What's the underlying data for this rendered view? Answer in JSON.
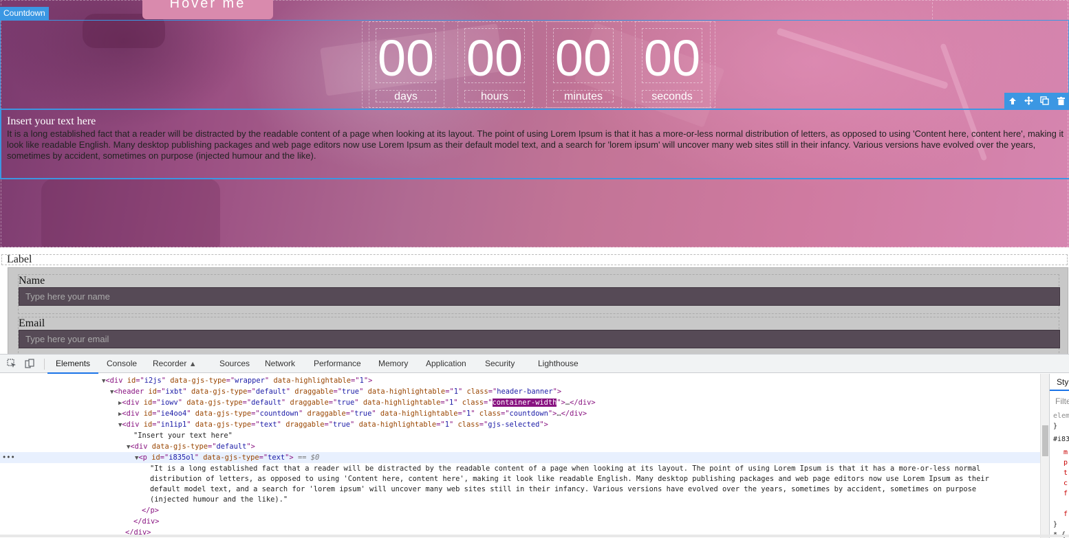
{
  "canvas": {
    "component_badge": "Countdown",
    "hover_button": "Hover me",
    "countdown": [
      {
        "value": "00",
        "label": "days"
      },
      {
        "value": "00",
        "label": "hours"
      },
      {
        "value": "00",
        "label": "minutes"
      },
      {
        "value": "00",
        "label": "seconds"
      }
    ],
    "toolbar_icons": [
      "arrow-up-icon",
      "move-icon",
      "copy-icon",
      "delete-icon"
    ],
    "text_block": {
      "title": "Insert your text here",
      "paragraph": "It is a long established fact that a reader will be distracted by the readable content of a page when looking at its layout. The point of using Lorem Ipsum is that it has a more-or-less normal distribution of letters, as opposed to using 'Content here, content here', making it look like readable English. Many desktop publishing packages and web page editors now use Lorem Ipsum as their default model text, and a search for 'lorem ipsum' will uncover many web sites still in their infancy. Various versions have evolved over the years, sometimes by accident, sometimes on purpose (injected humour and the like)."
    },
    "form": {
      "label": "Label",
      "name_label": "Name",
      "name_placeholder": "Type here your name",
      "email_label": "Email",
      "email_placeholder": "Type here your email"
    }
  },
  "devtools": {
    "tabs": [
      "Elements",
      "Console",
      "Recorder",
      "Sources",
      "Network",
      "Performance",
      "Memory",
      "Application",
      "Security",
      "Lighthouse"
    ],
    "active_tab": "Elements",
    "recorder_icon": "flask-icon",
    "styles_tab": "Styl",
    "styles_filter": "Filte",
    "styles_lines": [
      "elem",
      "}",
      "#i83",
      "m",
      "p",
      "t",
      "c",
      "f",
      "",
      "f",
      "}",
      "* {"
    ],
    "dom": {
      "line_wrapper": {
        "id": "i2js",
        "type": "wrapper",
        "highlightable": "1"
      },
      "line_header": {
        "id": "ixbt",
        "type": "default",
        "draggable": "true",
        "highlightable": "1",
        "class": "header-banner"
      },
      "line_iowv": {
        "id": "iowv",
        "type": "default",
        "draggable": "true",
        "highlightable": "1",
        "class": "container-width"
      },
      "line_ie4oo4": {
        "id": "ie4oo4",
        "type": "countdown",
        "draggable": "true",
        "highlightable": "1",
        "class": "countdown"
      },
      "line_in1ip1": {
        "id": "in1ip1",
        "type": "text",
        "draggable": "true",
        "highlightable": "1",
        "class": "gjs-selected"
      },
      "text_node": "\"Insert your text here\"",
      "line_default_div": {
        "type": "default"
      },
      "line_p": {
        "id": "i835ol",
        "type": "text",
        "console_ref": "== $0"
      },
      "p_text": [
        "\"It is a long established fact that a reader will be distracted by the readable content of a page when looking at its layout. The point of using Lorem Ipsum is that it has a more-or-less normal",
        "distribution of letters, as opposed to using 'Content here, content here', making it look like readable English. Many desktop publishing packages and web page editors now use Lorem Ipsum as their",
        "default model text, and a search for 'lorem ipsum' will uncover many web sites still in their infancy. Various versions have evolved over the years, sometimes by accident, sometimes on purpose",
        "(injected humour and the like).\""
      ]
    }
  },
  "colors": {
    "selection_blue": "#3b97e3",
    "tag_purple": "#881280",
    "attr_name": "#994500",
    "attr_value": "#1a1aa6"
  }
}
